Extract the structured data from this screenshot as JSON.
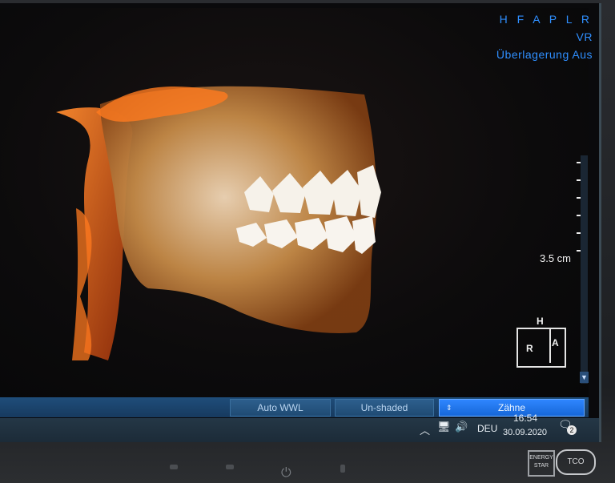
{
  "overlay": {
    "orientation_letters": "H F A P L R",
    "render_mode": "VR",
    "overlay_mode": "Überlagerung Aus"
  },
  "scale": {
    "label": "3.5 cm"
  },
  "orientation_cube": {
    "top": "H",
    "left": "R",
    "right": "A"
  },
  "bottom_toolbar": {
    "wwl": "Auto WWL",
    "shading": "Un-shaded",
    "preset": "Zähne"
  },
  "taskbar": {
    "language": "DEU",
    "time": "16:54",
    "date": "30.09.2020",
    "notifications": "2"
  },
  "icons": {
    "tray_up": "chevron-up-icon",
    "network": "network-icon",
    "volume": "volume-icon",
    "notification": "notification-icon",
    "power": "power-icon"
  }
}
